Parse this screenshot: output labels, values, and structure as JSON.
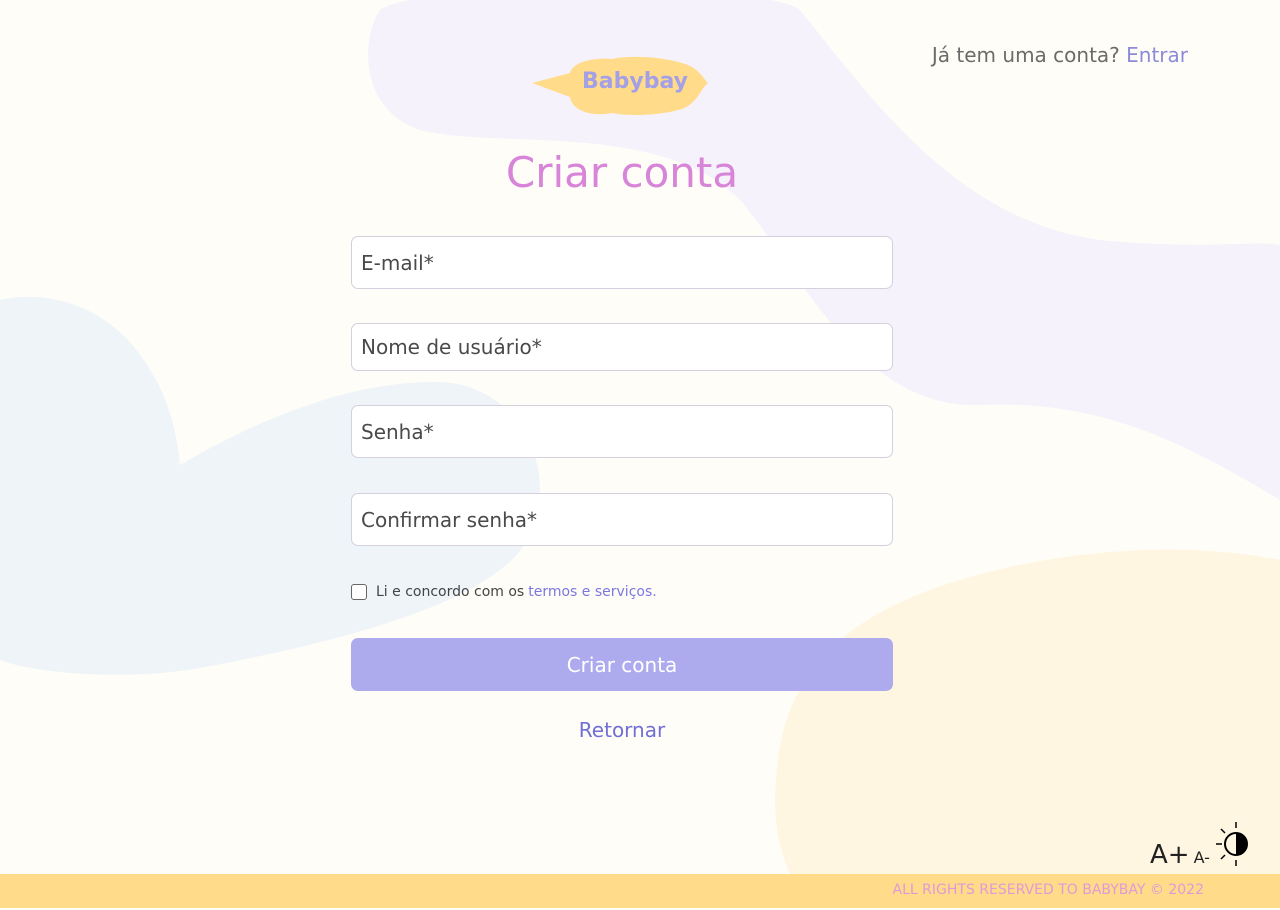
{
  "header": {
    "prompt_text": "Já tem uma conta?",
    "login_link": "Entrar"
  },
  "logo": {
    "text": "Babybay"
  },
  "form": {
    "title": "Criar conta",
    "fields": [
      {
        "placeholder": "E-mail*"
      },
      {
        "placeholder": "Nome de usuário*"
      },
      {
        "placeholder": "Senha*"
      },
      {
        "placeholder": "Confirmar senha*"
      }
    ],
    "terms_text": "Li e concordo com os",
    "terms_link": "termos e serviços.",
    "submit_label": "Criar conta",
    "back_label": "Retornar"
  },
  "accessibility": {
    "increase_font": "A+",
    "decrease_font": "A-"
  },
  "footer": {
    "text": "ALL RIGHTS RESERVED TO BABYBAY © 2022"
  },
  "colors": {
    "background": "#fffdf7",
    "accent_purple": "#aeaaee",
    "title_pink": "#d884d8",
    "logo_yellow": "#ffdb8a",
    "footer_yellow": "#ffdb8a"
  }
}
